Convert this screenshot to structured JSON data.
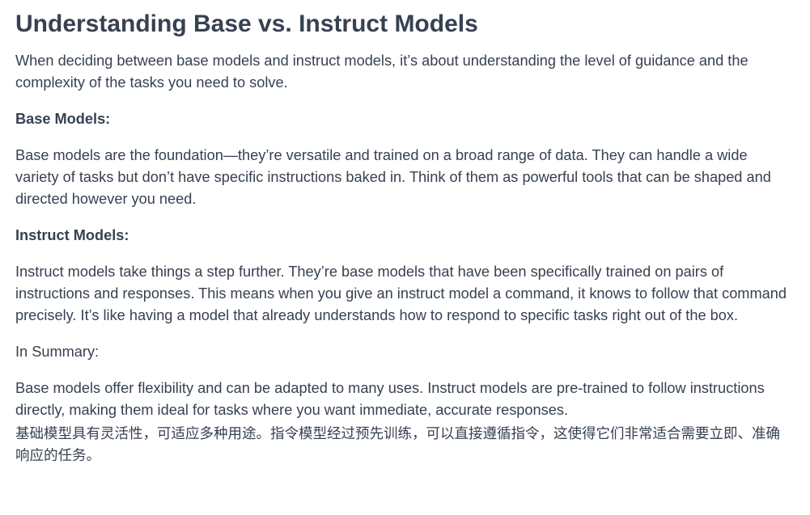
{
  "article": {
    "title": "Understanding Base vs. Instruct Models",
    "intro": "When deciding between base models and instruct models, it’s about understanding the level of guidance and the complexity of the tasks you need to solve.",
    "base_heading": "Base Models:",
    "base_body": "Base models are the foundation—they’re versatile and trained on a broad range of data. They can handle a wide variety of tasks but don’t have specific instructions baked in. Think of them as powerful tools that can be shaped and directed however you need.",
    "instruct_heading": "Instruct Models:",
    "instruct_body": "Instruct models take things a step further. They’re base models that have been specifically trained on pairs of instructions and responses. This means when you give an instruct model a command, it knows to follow that command precisely. It’s like having a model that already understands how to respond to specific tasks right out of the box.",
    "summary_heading": "In Summary:",
    "summary_body": "Base models offer flexibility and can be adapted to many uses. Instruct models are pre-trained to follow instructions directly, making them ideal for tasks where you want immediate, accurate responses.",
    "summary_chinese": "基础模型具有灵活性，可适应多种用途。指令模型经过预先训练，可以直接遵循指令，这使得它们非常适合需要立即、准确响应的任务。"
  }
}
